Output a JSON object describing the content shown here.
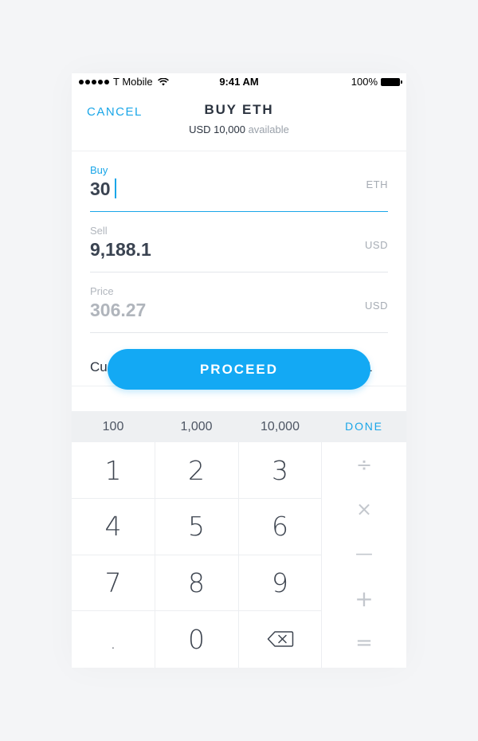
{
  "status_bar": {
    "carrier": "T Mobile",
    "time": "9:41 AM",
    "battery": "100%"
  },
  "header": {
    "cancel_label": "CANCEL",
    "title": "BUY ETH",
    "balance": "USD 10,000",
    "balance_suffix": "available"
  },
  "fields": {
    "buy": {
      "label": "Buy",
      "value": "30",
      "unit": "ETH"
    },
    "sell": {
      "label": "Sell",
      "value": "9,188.1",
      "unit": "USD"
    },
    "price": {
      "label": "Price",
      "value": "306.27",
      "unit": "USD"
    }
  },
  "currency_row": {
    "label_partial": "Cu",
    "value_partial": "1"
  },
  "proceed_label": "PROCEED",
  "quick_amounts": [
    "100",
    "1,000",
    "10,000"
  ],
  "done_label": "DONE",
  "keypad": {
    "digits": [
      "1",
      "2",
      "3",
      "4",
      "5",
      "6",
      "7",
      "8",
      "9",
      ".",
      "0"
    ],
    "operators": [
      "÷",
      "×",
      "—",
      "+",
      "="
    ]
  },
  "colors": {
    "accent": "#1aa6e8",
    "button": "#13a9f4",
    "text": "#3a4351",
    "muted": "#b0b5bc",
    "background": "#f4f5f7"
  }
}
